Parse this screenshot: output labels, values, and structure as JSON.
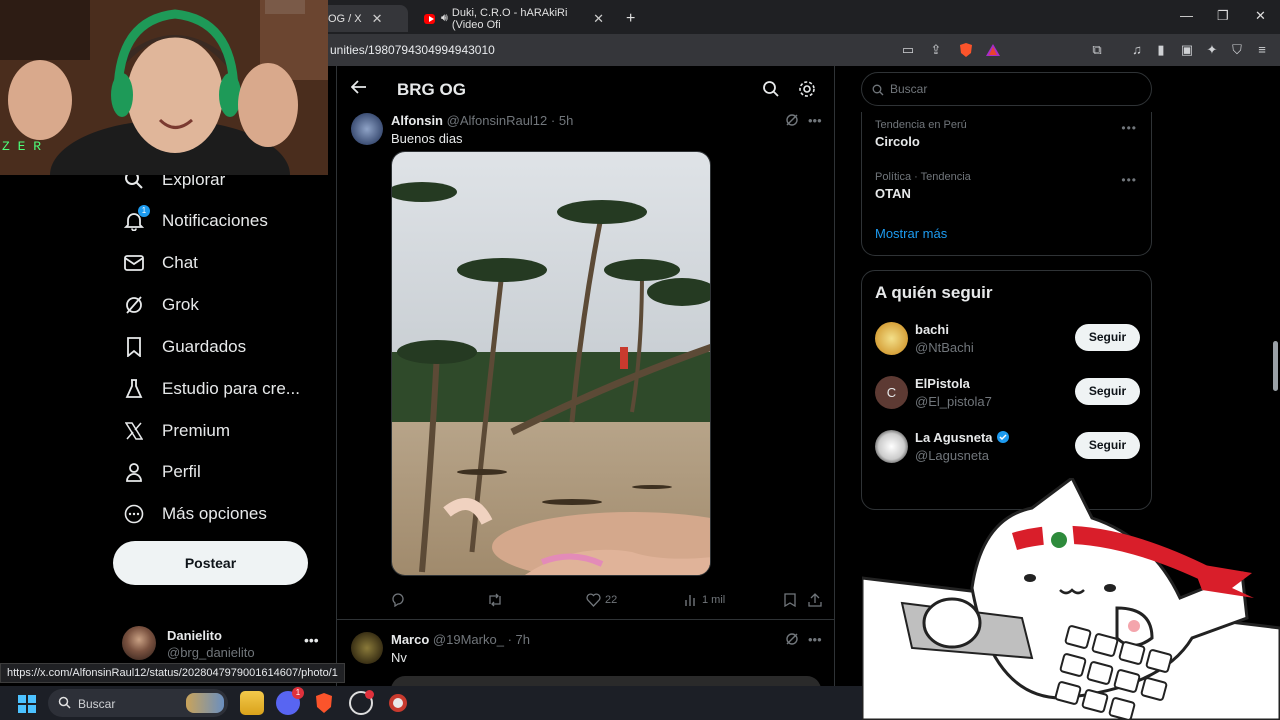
{
  "browser": {
    "tabs": [
      {
        "title": "OG / X",
        "active": true
      },
      {
        "title": "Duki, C.R.O - hARAkiRi (Video Ofi",
        "active": false
      }
    ],
    "new_tab": "+",
    "url": "unities/1980794304994943010",
    "status_url": "https://x.com/AlfonsinRaul12/status/2028047979001614607/photo/1"
  },
  "nav": {
    "items": [
      {
        "label": "Explorar",
        "icon": "search-icon"
      },
      {
        "label": "Notificaciones",
        "icon": "bell-icon",
        "badge": "1"
      },
      {
        "label": "Chat",
        "icon": "mail-icon"
      },
      {
        "label": "Grok",
        "icon": "grok-icon"
      },
      {
        "label": "Guardados",
        "icon": "bookmark-icon"
      },
      {
        "label": "Estudio para cre...",
        "icon": "flask-icon"
      },
      {
        "label": "Premium",
        "icon": "x-logo-icon"
      },
      {
        "label": "Perfil",
        "icon": "person-icon"
      },
      {
        "label": "Más opciones",
        "icon": "more-circle-icon"
      }
    ],
    "post_button": "Postear",
    "account": {
      "name": "Danielito",
      "handle": "@brg_danielito"
    }
  },
  "community": {
    "title": "BRG OG",
    "posts": [
      {
        "name": "Alfonsin",
        "handle": "@AlfonsinRaul12",
        "time": "5h",
        "text": "Buenos dias",
        "replies": "",
        "reposts": "",
        "likes": "22",
        "views": "1 mil"
      },
      {
        "name": "Marco",
        "handle": "@19Marko_",
        "time": "7h",
        "text": "Nv"
      }
    ]
  },
  "sidebar": {
    "search_placeholder": "Buscar",
    "trends": [
      {
        "context": "Tendencia en Perú",
        "title": "Circolo"
      },
      {
        "context": "Política · Tendencia",
        "title": "OTAN"
      }
    ],
    "show_more": "Mostrar más",
    "who_to_follow": {
      "title": "A quién seguir",
      "users": [
        {
          "name": "bachi",
          "handle": "@NtBachi",
          "button": "Seguir",
          "initial": ""
        },
        {
          "name": "ElPistola",
          "handle": "@El_pistola7",
          "button": "Seguir",
          "initial": "C"
        },
        {
          "name": "La Agusneta",
          "handle": "@Lagusneta",
          "button": "Seguir",
          "verified": true,
          "initial": ""
        }
      ]
    }
  },
  "webcam": {
    "overlay_text": "Z E R"
  },
  "taskbar": {
    "search_label": "Buscar",
    "discord_badge": "1"
  },
  "colors": {
    "accent": "#1d9bf0",
    "bg": "#000000",
    "border": "#2f3336",
    "muted": "#71767b"
  }
}
